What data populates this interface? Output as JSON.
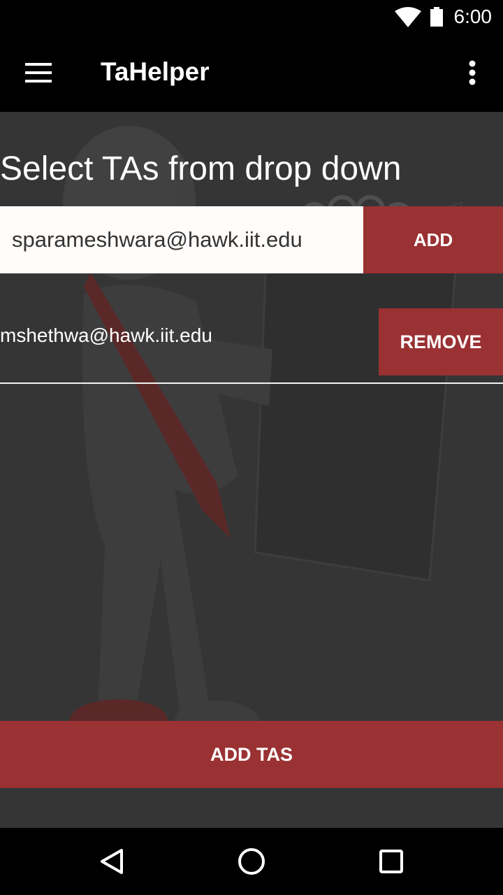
{
  "status_bar": {
    "time": "6:00",
    "icons": [
      "wifi-icon",
      "battery-icon"
    ]
  },
  "app_bar": {
    "title": "TaHelper",
    "left_icon": "menu-icon",
    "right_icon": "overflow-menu-icon"
  },
  "main": {
    "heading": "Select TAs from drop down",
    "spinner_value": "sparameshwara@hawk.iit.edu",
    "add_label": "ADD",
    "selected_tas": [
      {
        "email": "mshethwa@hawk.iit.edu",
        "remove_label": "REMOVE"
      }
    ],
    "submit_label": "ADD TAS"
  },
  "nav_bar": {
    "icons": [
      "back-icon",
      "home-icon",
      "recents-icon"
    ]
  },
  "colors": {
    "accent": "#9a3133",
    "content_bg": "#353535",
    "bars": "#000000",
    "spinner_bg": "#fffcfa"
  }
}
